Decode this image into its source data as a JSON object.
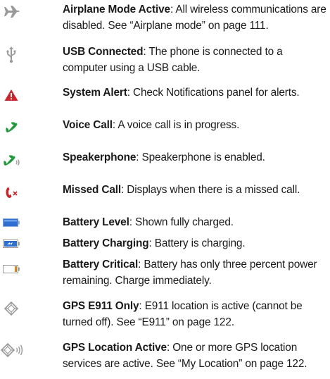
{
  "items": [
    {
      "icon": "airplane-icon",
      "term": "Airplane Mode Active",
      "desc": "All wireless communications are disabled. See “Airplane mode” on page 111."
    },
    {
      "icon": "usb-icon",
      "term": "USB Connected",
      "desc": "The phone is connected to a computer using a USB cable."
    },
    {
      "icon": "system-alert-icon",
      "term": "System Alert",
      "desc": "Check Notifications panel for alerts."
    },
    {
      "icon": "voice-call-icon",
      "term": "Voice Call",
      "desc": "A voice call is in progress."
    },
    {
      "icon": "speakerphone-icon",
      "term": "Speakerphone",
      "desc": "Speakerphone is enabled."
    },
    {
      "icon": "missed-call-icon",
      "term": "Missed Call",
      "desc": "Displays when there is a missed call."
    },
    {
      "icon": "battery-level-icon",
      "term": "Battery Level",
      "desc": "Shown fully charged."
    },
    {
      "icon": "battery-charging-icon",
      "term": "Battery Charging",
      "desc": "Battery is charging."
    },
    {
      "icon": "battery-critical-icon",
      "term": "Battery Critical",
      "desc": "Battery has only three percent power remaining. Charge immediately."
    },
    {
      "icon": "gps-e911-icon",
      "term": "GPS E911 Only",
      "desc": "E911 location is active (cannot be turned off). See “E911” on page 122."
    },
    {
      "icon": "gps-location-active-icon",
      "term": "GPS Location Active",
      "desc": "One or more GPS location services are active. See “My Location” on page 122."
    }
  ],
  "separator": ": ",
  "colors": {
    "text": "#1a1a1a",
    "icon_gray": "#9a9a9a",
    "alert_red": "#c8262a",
    "call_green": "#1f9a3a",
    "battery_blue": "#2f6fcf",
    "battery_orange": "#e0801e",
    "missed_red": "#c8262a"
  }
}
